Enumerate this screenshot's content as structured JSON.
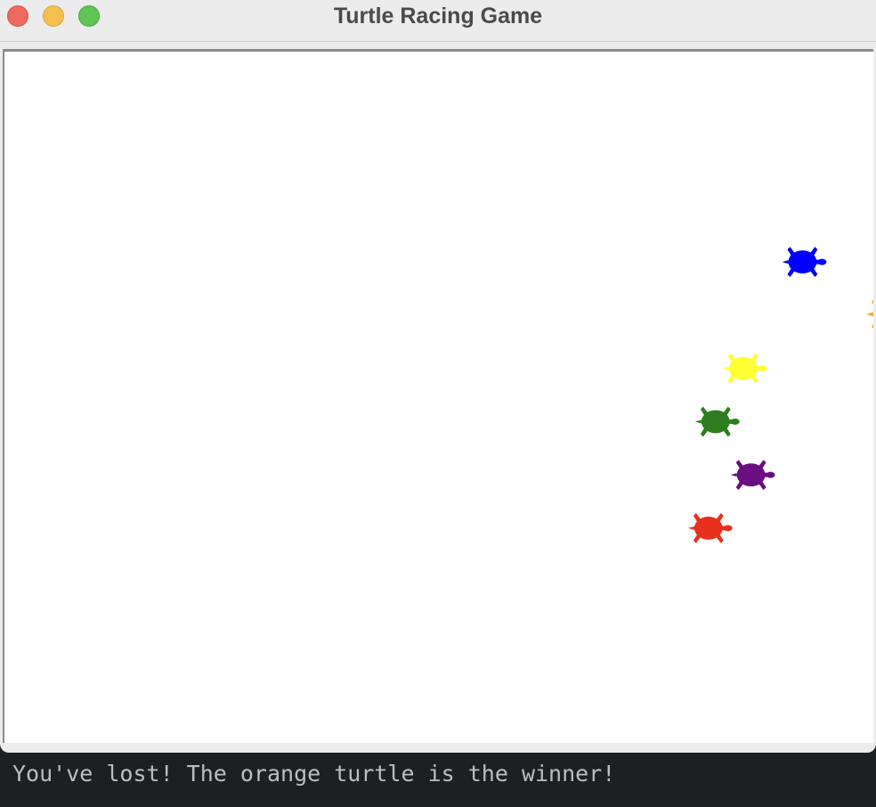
{
  "window": {
    "title": "Turtle Racing Game"
  },
  "turtles": [
    {
      "color_name": "blue",
      "color": "#0000ff",
      "icon": "turtle-icon"
    },
    {
      "color_name": "orange",
      "color": "#f5a623",
      "icon": "turtle-icon"
    },
    {
      "color_name": "yellow",
      "color": "#ffff33",
      "icon": "turtle-icon"
    },
    {
      "color_name": "green",
      "color": "#2e7d1e",
      "icon": "turtle-icon"
    },
    {
      "color_name": "purple",
      "color": "#6a0f7f",
      "icon": "turtle-icon"
    },
    {
      "color_name": "red",
      "color": "#e8301e",
      "icon": "turtle-icon"
    }
  ],
  "console": {
    "output": "You've lost! The orange turtle is the winner!"
  }
}
